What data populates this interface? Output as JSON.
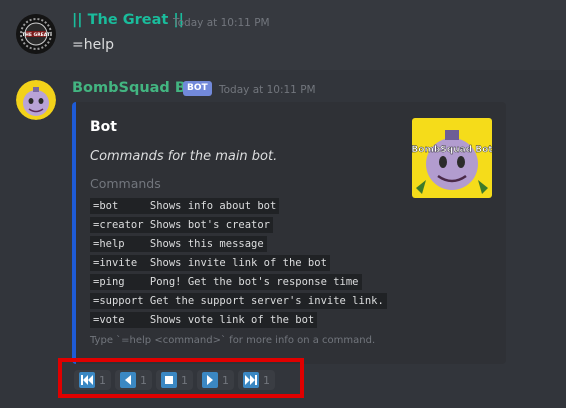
{
  "messages": [
    {
      "author": "|| The Great ||",
      "timestamp": "Today at 10:11 PM",
      "content": "=help",
      "avatar_text": "THE GREAT"
    },
    {
      "author": "BombSquad Bot",
      "bot_tag": "BOT",
      "timestamp": "Today at 10:11 PM",
      "embed": {
        "accent_color": "#1e5bd6",
        "title": "Bot",
        "description": "Commands for the main bot.",
        "field_name": "Commands",
        "commands": [
          "=bot     Shows info about bot",
          "=creator Shows bot's creator",
          "=help    Shows this message",
          "=invite  Shows invite link of the bot",
          "=ping    Pong! Get the bot's response time",
          "=support Get the support server's invite link.",
          "=vote    Shows vote link of the bot"
        ],
        "footer": "Type `=help <command>` for more info on a command.",
        "thumbnail_text": "BombSquad Bot"
      }
    }
  ],
  "reactions": [
    {
      "icon": "first-page-icon",
      "count": "1"
    },
    {
      "icon": "previous-icon",
      "count": "1"
    },
    {
      "icon": "stop-icon",
      "count": "1"
    },
    {
      "icon": "next-icon",
      "count": "1"
    },
    {
      "icon": "last-page-icon",
      "count": "1"
    }
  ],
  "colors": {
    "background": "#36393f",
    "embed_bg": "#2f3136",
    "username_1": "#1abc9c",
    "username_2": "#43b581",
    "bot_tag": "#7289da",
    "highlight": "#e00000"
  }
}
